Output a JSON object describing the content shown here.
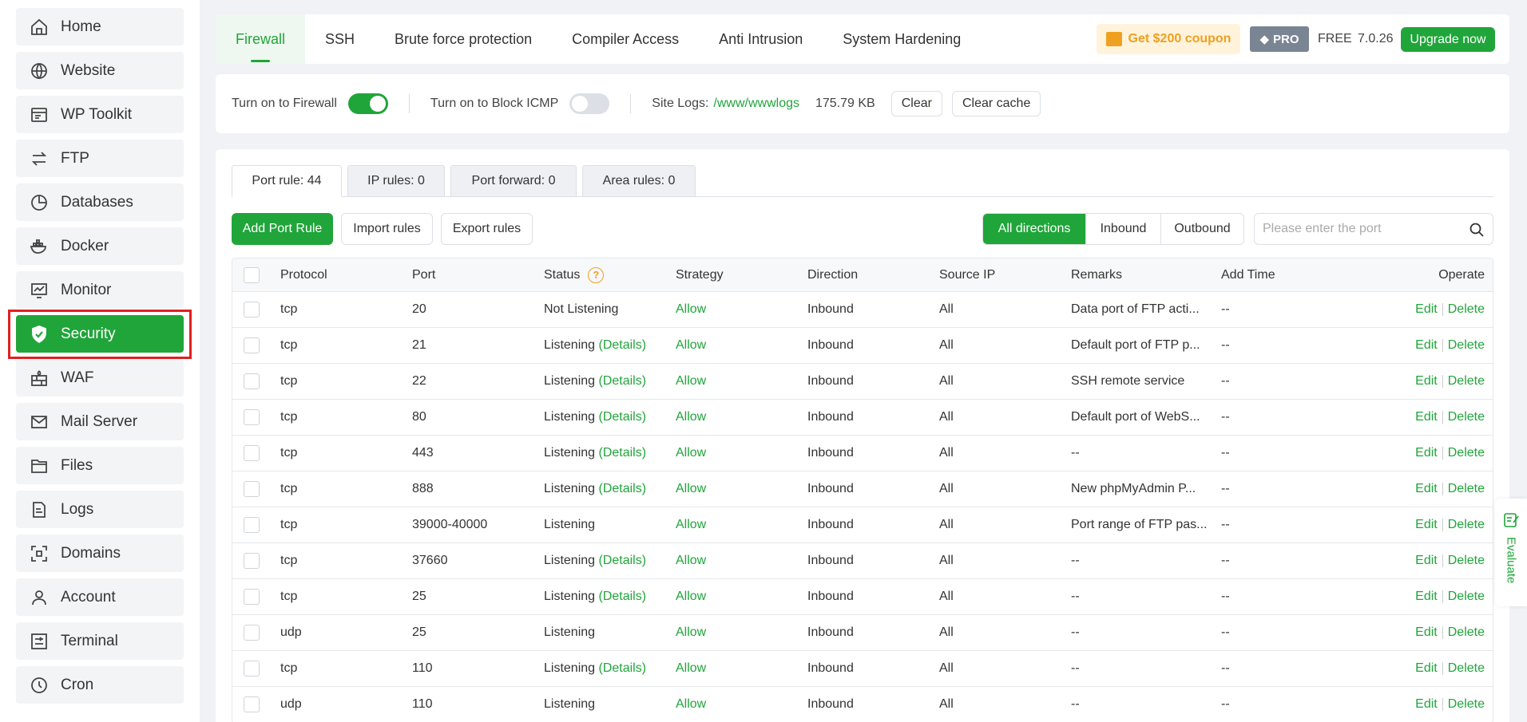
{
  "sidebar": {
    "items": [
      {
        "label": "Home",
        "icon": "home-icon"
      },
      {
        "label": "Website",
        "icon": "globe-icon"
      },
      {
        "label": "WP Toolkit",
        "icon": "wordpress-icon"
      },
      {
        "label": "FTP",
        "icon": "transfer-icon"
      },
      {
        "label": "Databases",
        "icon": "database-icon"
      },
      {
        "label": "Docker",
        "icon": "docker-icon"
      },
      {
        "label": "Monitor",
        "icon": "monitor-icon"
      },
      {
        "label": "Security",
        "icon": "shield-icon",
        "active": true
      },
      {
        "label": "WAF",
        "icon": "firewall-icon"
      },
      {
        "label": "Mail Server",
        "icon": "mail-icon"
      },
      {
        "label": "Files",
        "icon": "folder-icon"
      },
      {
        "label": "Logs",
        "icon": "log-icon"
      },
      {
        "label": "Domains",
        "icon": "domain-icon"
      },
      {
        "label": "Account",
        "icon": "user-icon"
      },
      {
        "label": "Terminal",
        "icon": "terminal-icon"
      },
      {
        "label": "Cron",
        "icon": "clock-icon"
      }
    ]
  },
  "topbar": {
    "tabs": [
      "Firewall",
      "SSH",
      "Brute force protection",
      "Compiler Access",
      "Anti Intrusion",
      "System Hardening"
    ],
    "coupon": "Get $200 coupon",
    "pro": "PRO",
    "free": "FREE",
    "version": "7.0.26",
    "upgrade": "Upgrade now"
  },
  "settings": {
    "firewall_label": "Turn on to Firewall",
    "firewall_on": true,
    "icmp_label": "Turn on to Block ICMP",
    "icmp_on": false,
    "site_logs_label": "Site Logs:",
    "site_logs_path": "/www/wwwlogs",
    "site_logs_size": "175.79 KB",
    "clear": "Clear",
    "clear_cache": "Clear cache"
  },
  "subtabs": [
    "Port rule: 44",
    "IP rules: 0",
    "Port forward: 0",
    "Area rules: 0"
  ],
  "actions": {
    "add": "Add Port Rule",
    "import": "Import rules",
    "export": "Export rules",
    "directions": [
      "All directions",
      "Inbound",
      "Outbound"
    ],
    "search_placeholder": "Please enter the port"
  },
  "table": {
    "headers": [
      "Protocol",
      "Port",
      "Status",
      "Strategy",
      "Direction",
      "Source IP",
      "Remarks",
      "Add Time",
      "Operate"
    ],
    "details_label": "(Details)",
    "edit_label": "Edit",
    "delete_label": "Delete",
    "rows": [
      {
        "protocol": "tcp",
        "port": "20",
        "status": "Not Listening",
        "details": false,
        "strategy": "Allow",
        "direction": "Inbound",
        "source": "All",
        "remarks": "Data port of FTP acti...",
        "time": "--"
      },
      {
        "protocol": "tcp",
        "port": "21",
        "status": "Listening",
        "details": true,
        "strategy": "Allow",
        "direction": "Inbound",
        "source": "All",
        "remarks": "Default port of FTP p...",
        "time": "--"
      },
      {
        "protocol": "tcp",
        "port": "22",
        "status": "Listening",
        "details": true,
        "strategy": "Allow",
        "direction": "Inbound",
        "source": "All",
        "remarks": "SSH remote service",
        "time": "--"
      },
      {
        "protocol": "tcp",
        "port": "80",
        "status": "Listening",
        "details": true,
        "strategy": "Allow",
        "direction": "Inbound",
        "source": "All",
        "remarks": "Default port of WebS...",
        "time": "--"
      },
      {
        "protocol": "tcp",
        "port": "443",
        "status": "Listening",
        "details": true,
        "strategy": "Allow",
        "direction": "Inbound",
        "source": "All",
        "remarks": "--",
        "time": "--"
      },
      {
        "protocol": "tcp",
        "port": "888",
        "status": "Listening",
        "details": true,
        "strategy": "Allow",
        "direction": "Inbound",
        "source": "All",
        "remarks": "New phpMyAdmin P...",
        "time": "--"
      },
      {
        "protocol": "tcp",
        "port": "39000-40000",
        "status": "Listening",
        "details": false,
        "strategy": "Allow",
        "direction": "Inbound",
        "source": "All",
        "remarks": "Port range of FTP pas...",
        "time": "--"
      },
      {
        "protocol": "tcp",
        "port": "37660",
        "status": "Listening",
        "details": true,
        "strategy": "Allow",
        "direction": "Inbound",
        "source": "All",
        "remarks": "--",
        "time": "--"
      },
      {
        "protocol": "tcp",
        "port": "25",
        "status": "Listening",
        "details": true,
        "strategy": "Allow",
        "direction": "Inbound",
        "source": "All",
        "remarks": "--",
        "time": "--"
      },
      {
        "protocol": "udp",
        "port": "25",
        "status": "Listening",
        "details": false,
        "strategy": "Allow",
        "direction": "Inbound",
        "source": "All",
        "remarks": "--",
        "time": "--"
      },
      {
        "protocol": "tcp",
        "port": "110",
        "status": "Listening",
        "details": true,
        "strategy": "Allow",
        "direction": "Inbound",
        "source": "All",
        "remarks": "--",
        "time": "--"
      },
      {
        "protocol": "udp",
        "port": "110",
        "status": "Listening",
        "details": false,
        "strategy": "Allow",
        "direction": "Inbound",
        "source": "All",
        "remarks": "--",
        "time": "--"
      }
    ]
  },
  "evaluate": "Evaluate",
  "colors": {
    "accent": "#20a53a",
    "highlight": "#e02020",
    "coupon": "#f0a020"
  }
}
